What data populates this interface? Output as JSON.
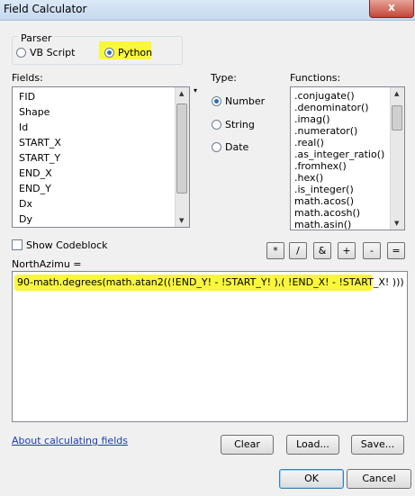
{
  "window": {
    "title": "Field Calculator",
    "close_glyph": "x"
  },
  "parser": {
    "label": "Parser",
    "options": [
      {
        "label": "VB Script",
        "selected": false
      },
      {
        "label": "Python",
        "selected": true
      }
    ]
  },
  "fields": {
    "label": "Fields:",
    "items": [
      "FID",
      "Shape",
      "Id",
      "START_X",
      "START_Y",
      "END_X",
      "END_Y",
      "Dx",
      "Dy"
    ]
  },
  "type": {
    "label": "Type:",
    "options": [
      {
        "label": "Number",
        "selected": true
      },
      {
        "label": "String",
        "selected": false
      },
      {
        "label": "Date",
        "selected": false
      }
    ]
  },
  "functions": {
    "label": "Functions:",
    "items": [
      ".conjugate()",
      ".denominator()",
      ".imag()",
      ".numerator()",
      ".real()",
      ".as_integer_ratio()",
      ".fromhex()",
      ".hex()",
      ".is_integer()",
      "math.acos()",
      "math.acosh()",
      "math.asin()"
    ]
  },
  "codeblock": {
    "label": "Show Codeblock",
    "checked": false
  },
  "operators": [
    "*",
    "/",
    "&",
    "+",
    "-",
    "="
  ],
  "expression": {
    "label": "NorthAzimu =",
    "value": "90-math.degrees(math.atan2((!END_Y! - !START_Y! ),( !END_X! - !START_X! )))",
    "highlight_color": "#f9f73a"
  },
  "links": {
    "about": "About calculating fields"
  },
  "buttons": {
    "clear": "Clear",
    "load": "Load...",
    "save": "Save...",
    "ok": "OK",
    "cancel": "Cancel"
  }
}
